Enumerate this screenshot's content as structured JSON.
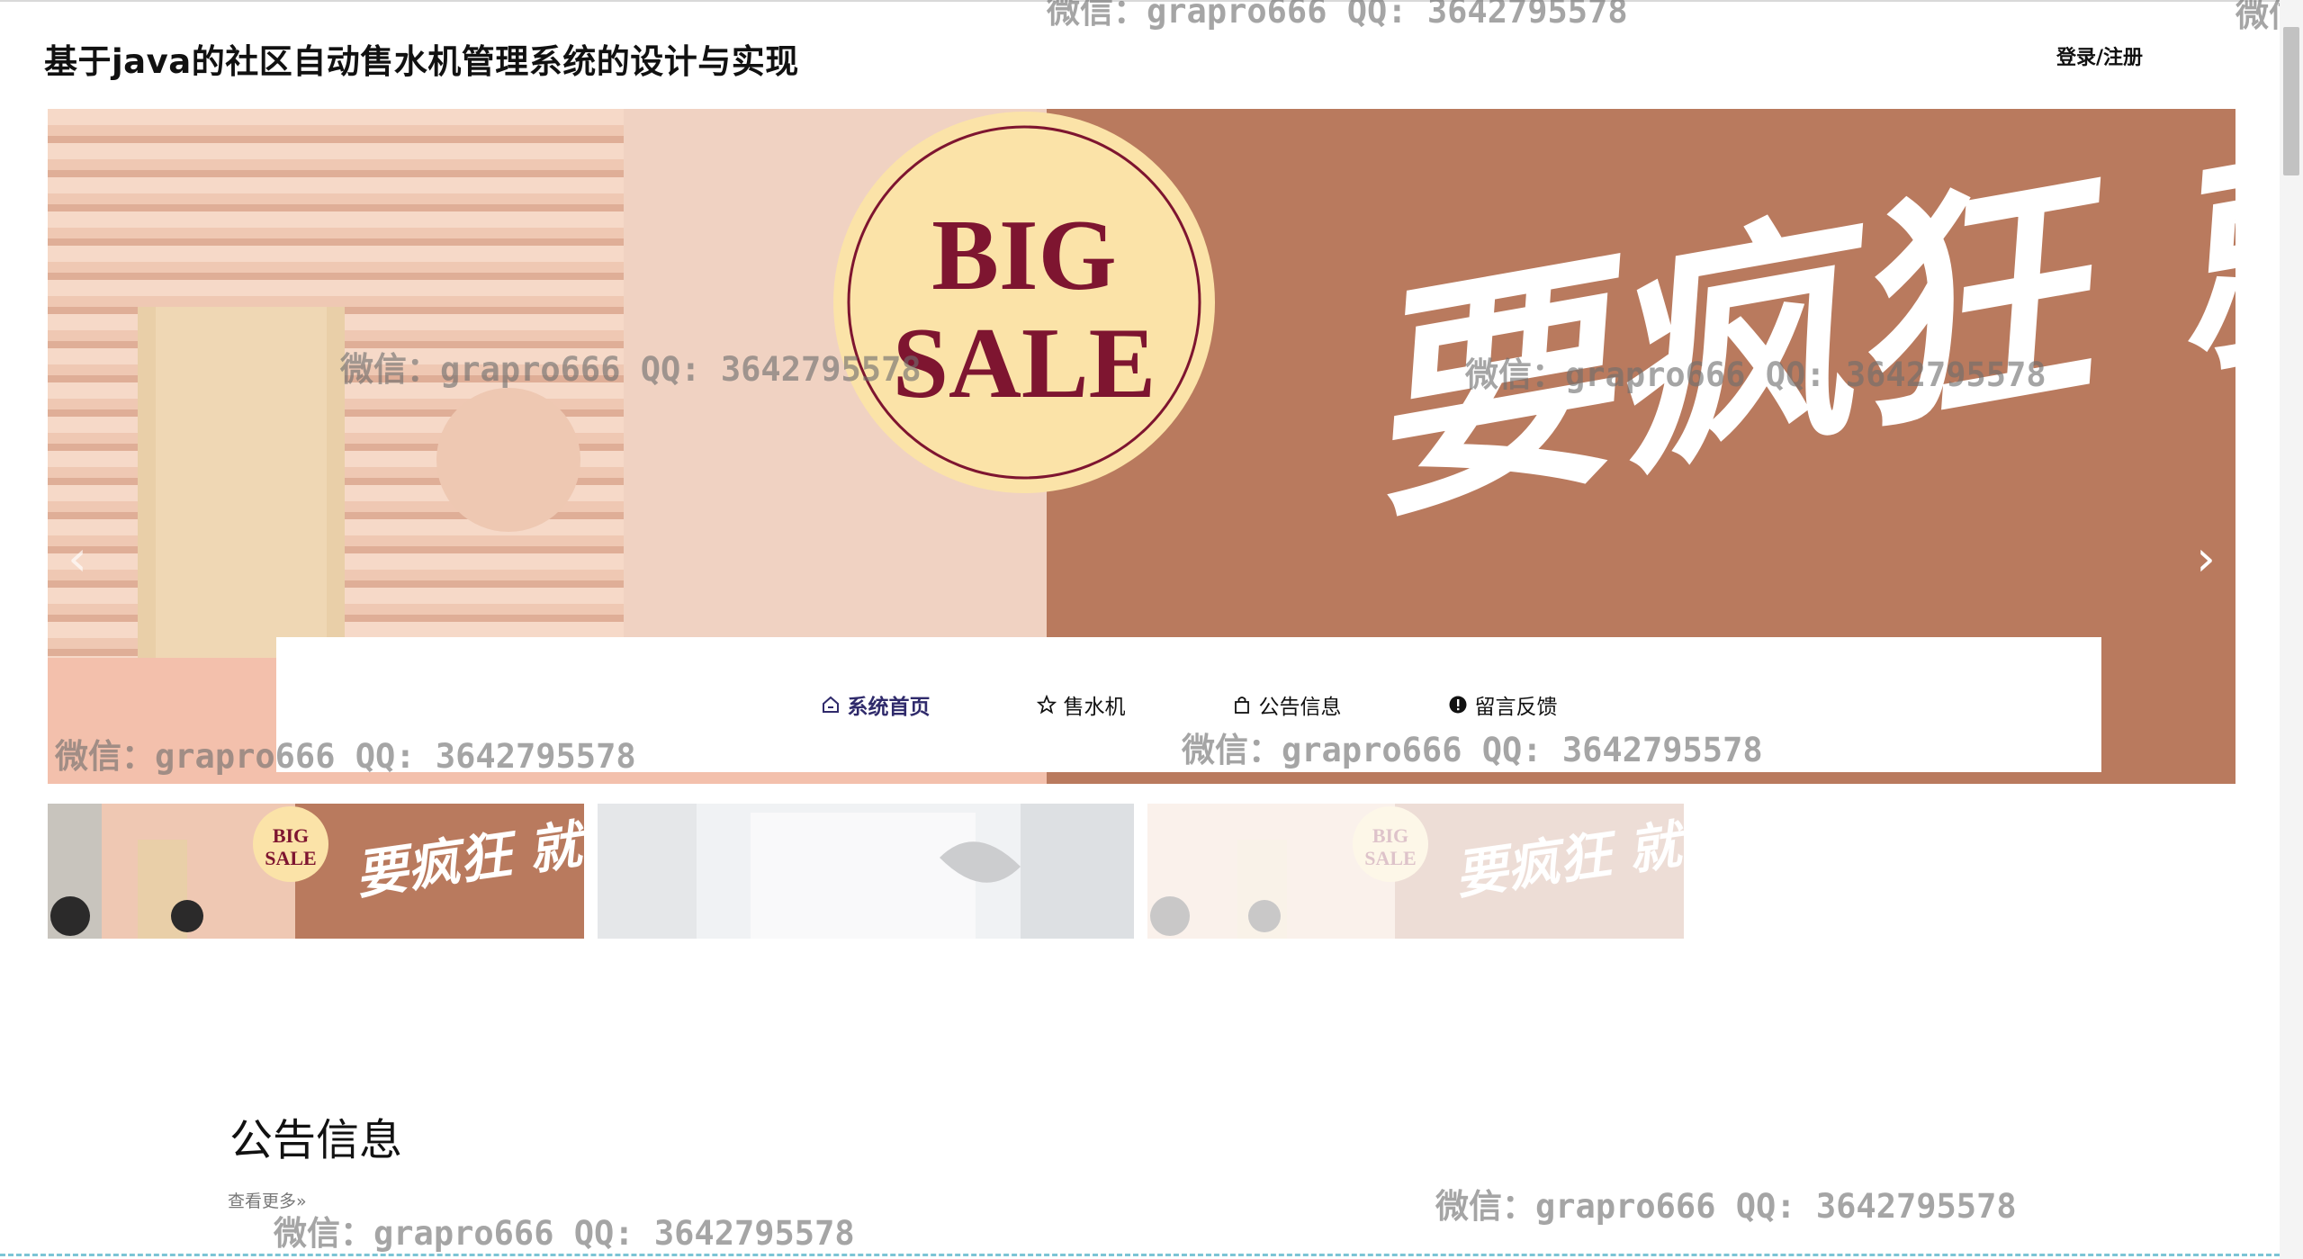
{
  "header": {
    "title": "基于java的社区自动售水机管理系统的设计与实现",
    "login_label": "登录/注册"
  },
  "carousel": {
    "banner_text": [
      "BIG",
      "SALE"
    ],
    "slogan": "要疯狂 就彻底",
    "prev_icon": "chevron-left-icon",
    "next_icon": "chevron-right-icon",
    "slide_count": 3,
    "active_slide": 1
  },
  "nav": {
    "items": [
      {
        "label": "系统首页",
        "icon": "home-icon",
        "active": true
      },
      {
        "label": "售水机",
        "icon": "star-icon",
        "active": false
      },
      {
        "label": "公告信息",
        "icon": "bag-icon",
        "active": false
      },
      {
        "label": "留言反馈",
        "icon": "alert-circle-icon",
        "active": false
      }
    ]
  },
  "notice": {
    "title": "公告信息",
    "more_label": "查看更多»"
  },
  "watermark": {
    "text": "微信：grapro666 QQ: 3642795578",
    "corner_text": "微信"
  },
  "colors": {
    "banner_brown": "#b97a5e",
    "banner_peach": "#efc8b3",
    "sale_circle": "#fbe3a8",
    "sale_text": "#7e1530",
    "nav_active": "#2f2a6b"
  }
}
